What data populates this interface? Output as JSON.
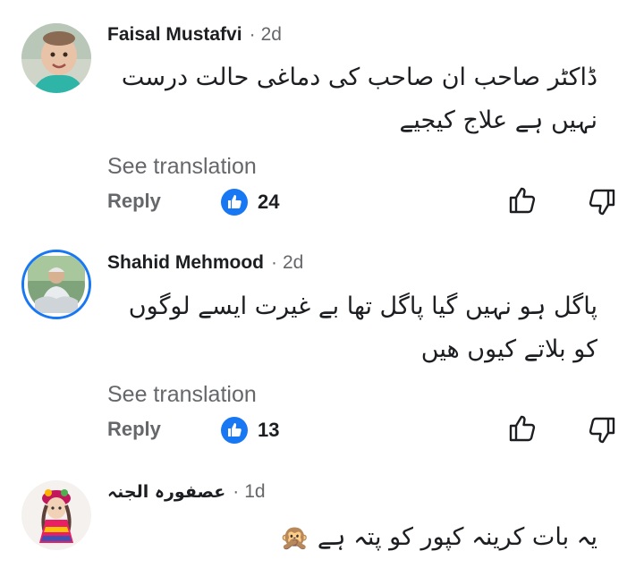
{
  "comments": [
    {
      "author": "Faisal Mustafvi",
      "time": "2d",
      "text_line1": "ڈاکٹر صاحب ان صاحب کی دماغی حالت درست",
      "text_line2": "نہیں ہے      علاج کیجیے",
      "see_translation": "See translation",
      "reply": "Reply",
      "likes": "24",
      "avatar_icon": "child-photo-avatar"
    },
    {
      "author": "Shahid Mehmood",
      "time": "2d",
      "text_line1": "پاگل ہو نہیں گیا پاگل تھا بے غیرت ایسے لوگوں",
      "text_line2": "کو بلاتے کیوں ھیں",
      "see_translation": "See translation",
      "reply": "Reply",
      "likes": "13",
      "avatar_icon": "man-photo-avatar"
    },
    {
      "author": "عصفورہ الجنہ",
      "time": "1d",
      "text_line1": "یہ بات کرینہ کپور کو پتہ ہے",
      "emoji": "🙊",
      "avatar_icon": "doll-photo-avatar"
    }
  ],
  "separator": "·",
  "colors": {
    "like_blue": "#1877f2",
    "meta_gray": "#65676b",
    "text": "#1c1e21"
  }
}
